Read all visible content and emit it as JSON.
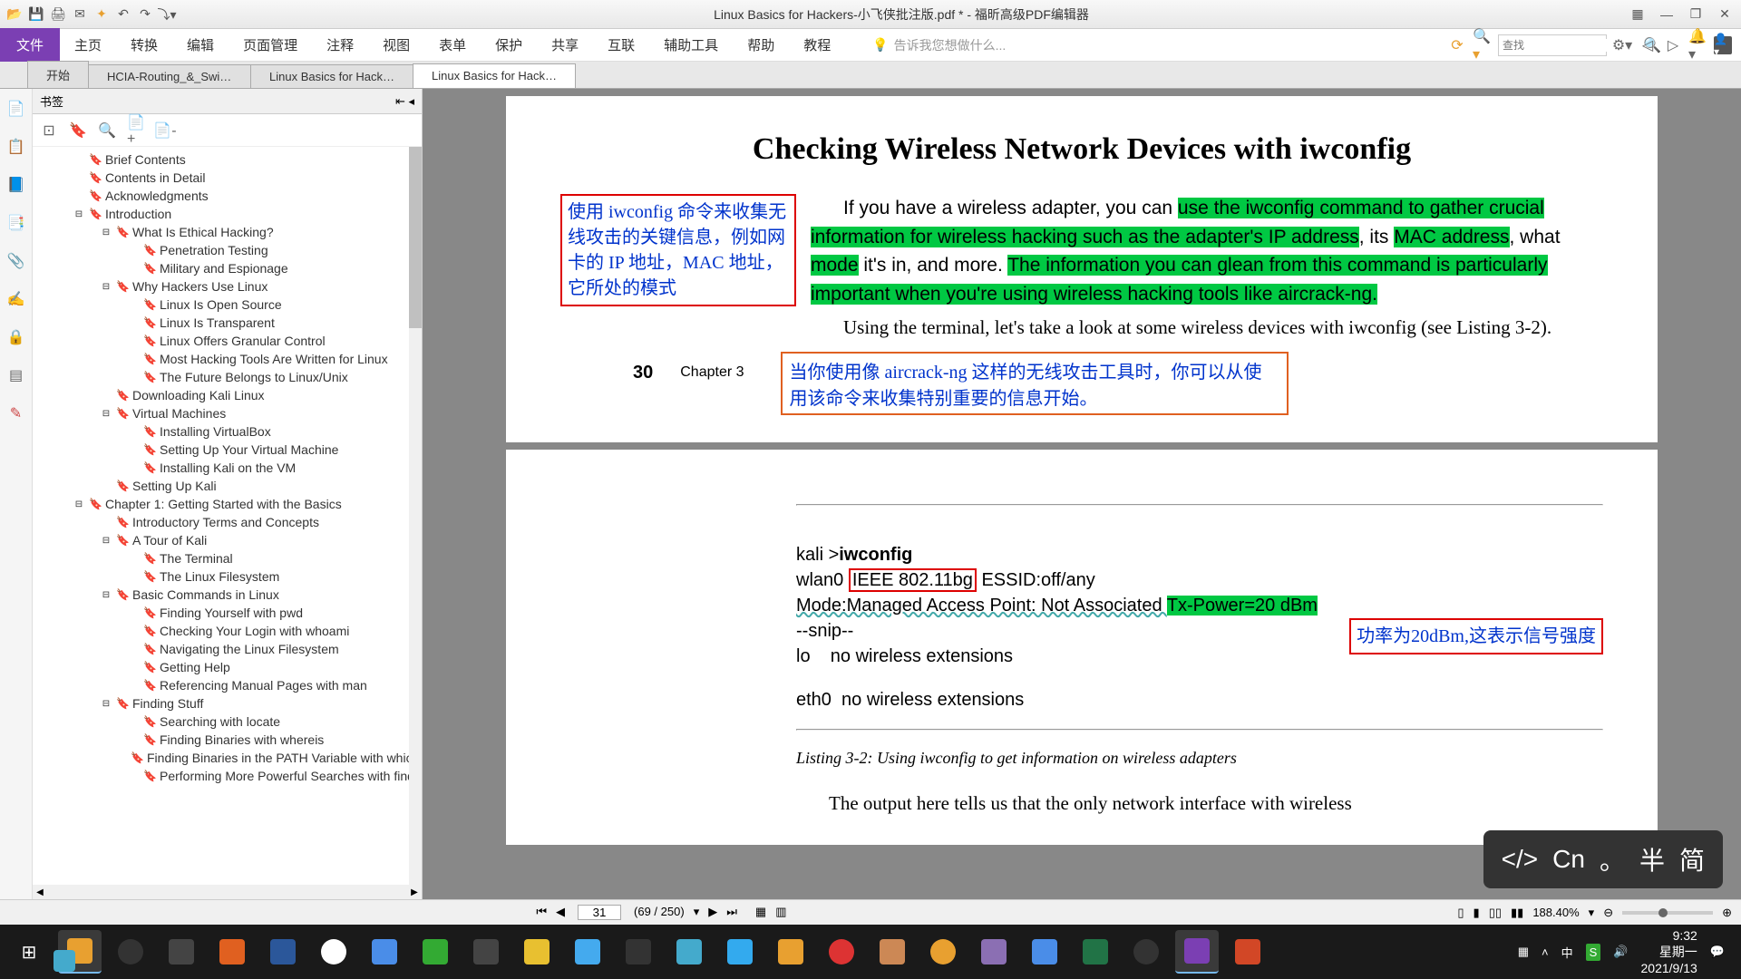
{
  "titlebar": {
    "title": "Linux Basics for Hackers-小飞侠批注版.pdf * - 福昕高级PDF编辑器"
  },
  "menu": {
    "file": "文件",
    "items": [
      "主页",
      "转换",
      "编辑",
      "页面管理",
      "注释",
      "视图",
      "表单",
      "保护",
      "共享",
      "互联",
      "辅助工具",
      "帮助",
      "教程"
    ],
    "search_placeholder": "告诉我您想做什么...",
    "find_placeholder": "查找"
  },
  "tabs": [
    {
      "label": "开始",
      "active": false,
      "closable": false
    },
    {
      "label": "HCIA-Routing_&_Switc...",
      "active": false,
      "closable": false
    },
    {
      "label": "Linux Basics for Hacker...",
      "active": false,
      "closable": false
    },
    {
      "label": "Linux Basics for Hackers...",
      "active": true,
      "closable": true
    }
  ],
  "bookmarks": {
    "title": "书签",
    "items": [
      {
        "label": "Brief Contents",
        "level": 1,
        "expand": ""
      },
      {
        "label": "Contents in Detail",
        "level": 1,
        "expand": ""
      },
      {
        "label": "Acknowledgments",
        "level": 1,
        "expand": ""
      },
      {
        "label": "Introduction",
        "level": 1,
        "expand": "⊟"
      },
      {
        "label": "What Is Ethical Hacking?",
        "level": 2,
        "expand": "⊟"
      },
      {
        "label": "Penetration Testing",
        "level": 3,
        "expand": ""
      },
      {
        "label": "Military and Espionage",
        "level": 3,
        "expand": ""
      },
      {
        "label": "Why Hackers Use Linux",
        "level": 2,
        "expand": "⊟"
      },
      {
        "label": "Linux Is Open Source",
        "level": 3,
        "expand": ""
      },
      {
        "label": "Linux Is Transparent",
        "level": 3,
        "expand": ""
      },
      {
        "label": "Linux Offers Granular Control",
        "level": 3,
        "expand": ""
      },
      {
        "label": "Most Hacking Tools Are Written for Linux",
        "level": 3,
        "expand": ""
      },
      {
        "label": "The Future Belongs to Linux/Unix",
        "level": 3,
        "expand": ""
      },
      {
        "label": "Downloading Kali Linux",
        "level": 2,
        "expand": ""
      },
      {
        "label": "Virtual Machines",
        "level": 2,
        "expand": "⊟"
      },
      {
        "label": "Installing VirtualBox",
        "level": 3,
        "expand": ""
      },
      {
        "label": "Setting Up Your Virtual Machine",
        "level": 3,
        "expand": ""
      },
      {
        "label": "Installing Kali on the VM",
        "level": 3,
        "expand": ""
      },
      {
        "label": "Setting Up Kali",
        "level": 2,
        "expand": ""
      },
      {
        "label": "Chapter 1: Getting Started with the Basics",
        "level": 1,
        "expand": "⊟"
      },
      {
        "label": "Introductory Terms and Concepts",
        "level": 2,
        "expand": ""
      },
      {
        "label": "A Tour of Kali",
        "level": 2,
        "expand": "⊟"
      },
      {
        "label": "The Terminal",
        "level": 3,
        "expand": ""
      },
      {
        "label": "The Linux Filesystem",
        "level": 3,
        "expand": ""
      },
      {
        "label": "Basic Commands in Linux",
        "level": 2,
        "expand": "⊟"
      },
      {
        "label": "Finding Yourself with pwd",
        "level": 3,
        "expand": ""
      },
      {
        "label": "Checking Your Login with whoami",
        "level": 3,
        "expand": ""
      },
      {
        "label": "Navigating the Linux Filesystem",
        "level": 3,
        "expand": ""
      },
      {
        "label": "Getting Help",
        "level": 3,
        "expand": ""
      },
      {
        "label": "Referencing Manual Pages with man",
        "level": 3,
        "expand": ""
      },
      {
        "label": "Finding Stuff",
        "level": 2,
        "expand": "⊟"
      },
      {
        "label": "Searching with locate",
        "level": 3,
        "expand": ""
      },
      {
        "label": "Finding Binaries with whereis",
        "level": 3,
        "expand": ""
      },
      {
        "label": "Finding Binaries in the PATH Variable with which",
        "level": 3,
        "expand": ""
      },
      {
        "label": "Performing More Powerful Searches with find",
        "level": 3,
        "expand": ""
      }
    ]
  },
  "document": {
    "heading": "Checking Wireless Network Devices with iwconfig",
    "annotation1": "使用 iwconfig 命令来收集无线攻击的关键信息，例如网卡的 IP 地址，MAC 地址，它所处的模式",
    "para_pre": "If you have a wireless adapter, you can ",
    "hl1": "use the iwconfig command to gather crucial information for wireless hacking such as the adapter's IP address",
    "para_mid1": ", its ",
    "hl2": "MAC address",
    "para_mid2": ", what ",
    "hl3": "mode",
    "para_mid3": " it's in, and more. ",
    "hl4": "The information you can glean from this command is particularly important when you're using wireless hacking tools like aircrack-ng.",
    "para2": "Using the terminal, let's take a look at some wireless devices with iwconfig (see Listing 3-2).",
    "annotation2": "当你使用像 aircrack-ng 这样的无线攻击工具时，你可以从使用该命令来收集特别重要的信息开始。",
    "page_num": "30",
    "chapter": "Chapter 3",
    "term_prompt": "kali >",
    "term_cmd": "iwconfig",
    "term_l2a": "wlan0",
    "term_l2b": "IEEE 802.11bg",
    "term_l2c": "ESSID:off/any",
    "term_l3a": "Mode:Managed Access Point: Not Associated ",
    "term_l3b": "Tx-Power=20 dBm",
    "term_snip": "--snip--",
    "annotation3": "功率为20dBm,这表示信号强度",
    "term_lo": "lo    no wireless extensions",
    "term_eth": "eth0  no wireless extensions",
    "caption": "Listing 3-2: Using iwconfig to get information on wireless adapters",
    "para3": "The output here tells us that the only network interface with wireless"
  },
  "statusbar": {
    "page_current": "31",
    "page_total": "(69 / 250)",
    "zoom": "188.40%"
  },
  "ime": {
    "code_label": "</>",
    "lang": "Cn",
    "punct": "。",
    "half": "半",
    "simp": "简"
  },
  "systray": {
    "time": "9:32",
    "day": "星期一",
    "date": "2021/9/13"
  }
}
